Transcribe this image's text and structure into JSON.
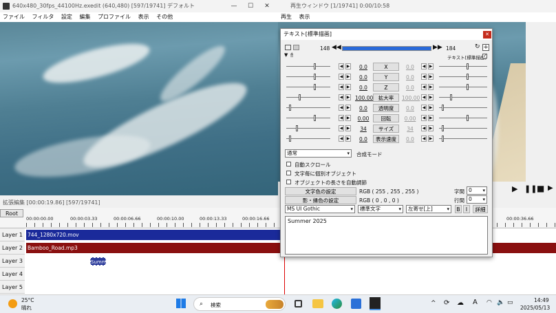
{
  "editor": {
    "title": "640x480_30fps_44100Hz.exedit (640,480)  [597/19741]  デフォルト",
    "menu": [
      "ファイル",
      "フィルタ",
      "設定",
      "編集",
      "プロファイル",
      "表示",
      "その他"
    ]
  },
  "player": {
    "title": "再生ウィンドウ  [1/19741]  0:00/10:58",
    "menu": [
      "再生",
      "表示"
    ]
  },
  "dialog": {
    "title": "テキスト[標準描画]",
    "frame_start": "148",
    "frame_end": "184",
    "frame_progress": 1.0,
    "mode_label": "テキスト[標準描画]",
    "rows": [
      {
        "label": "X",
        "left": "0.0",
        "right": "0.0"
      },
      {
        "label": "Y",
        "left": "0.0",
        "right": "0.0"
      },
      {
        "label": "Z",
        "left": "0.0",
        "right": "0.0"
      },
      {
        "label": "拡大率",
        "left": "100.00",
        "right": "100.00"
      },
      {
        "label": "透明度",
        "left": "0.0",
        "right": "0.0"
      },
      {
        "label": "回転",
        "left": "0.00",
        "right": "0.00"
      },
      {
        "label": "サイズ",
        "left": "34",
        "right": "34"
      },
      {
        "label": "表示速度",
        "left": "0.0",
        "right": "0.0"
      }
    ],
    "blend_value": "通常",
    "blend_label": "合成モード",
    "checks": [
      "自動スクロール",
      "文字毎に個別オブジェクト",
      "オブジェクトの長さを自動調節"
    ],
    "text_color_btn": "文字色の設定",
    "text_color_val": "RGB ( 255 , 255 , 255 )",
    "shadow_color_btn": "影・縁色の設定",
    "shadow_color_val": "RGB ( 0 , 0 , 0 )",
    "spacing_label": "字間",
    "spacing_val": "0",
    "line_label": "行間",
    "line_val": "0",
    "font": "MS UI Gothic",
    "style": "標準文字",
    "align": "左寄せ[上]",
    "bold": "B",
    "italic": "I",
    "detail": "詳細",
    "text": "Summer 2025"
  },
  "timeline": {
    "title": "拡張編集 [00:00:19.86] [597/19741]",
    "root": "Root",
    "ticks": [
      "00:00:00.00",
      "00:00:03.33",
      "00:00:06.66",
      "00:00:10.00",
      "00:00:13.33",
      "00:00:16.66",
      "00:00:36.66"
    ],
    "layers": [
      "Layer 1",
      "Layer 2",
      "Layer 3",
      "Layer 4",
      "Layer 5"
    ],
    "clip1": "744_1280x720.mov",
    "clip2": "Bamboo_Road.mp3",
    "clip3": "Summ"
  },
  "taskbar": {
    "temp": "25°C",
    "weather": "晴れ",
    "search": "検索",
    "time": "14:49",
    "date": "2025/05/13",
    "ime": "A"
  }
}
